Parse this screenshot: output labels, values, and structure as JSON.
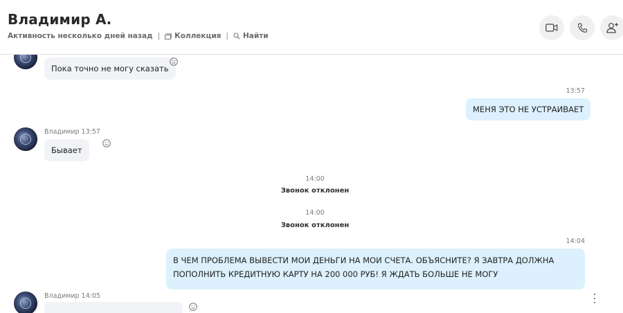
{
  "header": {
    "name": "Владимир А.",
    "status": "Активность несколько дней назад",
    "separator": "|",
    "gallery_label": "Коллекция",
    "search_label": "Найти"
  },
  "actions": {
    "video_call_icon": "video-camera",
    "audio_call_icon": "phone",
    "add_people_icon": "add-person"
  },
  "messages": {
    "m1": {
      "text": "Пока точно не могу сказать"
    },
    "m2": {
      "time": "13:57",
      "text": "МЕНЯ ЭТО НЕ УСТРАИВАЕТ"
    },
    "m3": {
      "author_time": "Владимир 13:57",
      "text": "Бывает"
    },
    "s1": {
      "time": "14:00",
      "text": "Звонок отклонен"
    },
    "s2": {
      "time": "14:00",
      "text": "Звонок отклонен"
    },
    "m4": {
      "time": "14:04",
      "line1": "В ЧЕМ ПРОБЛЕМА ВЫВЕСТИ МОИ ДЕНЬГИ НА МОИ СЧЕТА. ОБЪЯСНИТЕ? Я ЗАВТРА ДОЛЖНА",
      "line2": "ПОПОЛНИТЬ КРЕДИТНУЮ КАРТУ НА 200 000 РУБ!  Я ЖДАТЬ БОЛЬШЕ НЕ МОГУ"
    },
    "m5": {
      "author_time": "Владимир 14:05"
    }
  },
  "colors": {
    "incoming_bubble": "#f1f3f6",
    "outgoing_bubble": "#dcf1fd",
    "header_button": "#f0f0f0"
  }
}
